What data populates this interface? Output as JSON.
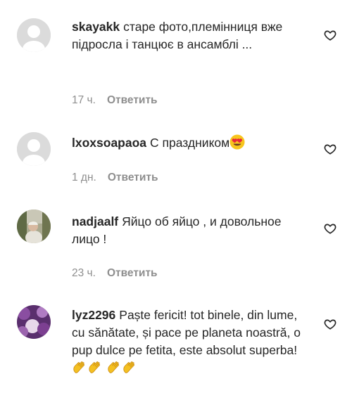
{
  "comments": [
    {
      "username": "skayakk",
      "text": "старе фото,племінниця вже підросла і танцює в ансамблі ...",
      "time": "17 ч.",
      "reply_label": "Ответить",
      "avatar": "default-avatar"
    },
    {
      "username": "lxoxsoapaoa",
      "text": "С праздником",
      "emoji": "heart-eyes-emoji",
      "time": "1 дн.",
      "reply_label": "Ответить",
      "avatar": "default-avatar"
    },
    {
      "username": "nadjaalf",
      "text": "Яйцо об яйцо , и довольное лицо !",
      "time": "23 ч.",
      "reply_label": "Ответить",
      "avatar": "photo-avatar"
    },
    {
      "username": "lyz2296",
      "text": "Paște fericit! tot binele, din lume, cu sănătate, și pace pe planeta noastră, o pup dulce pe fetita, este absolut superba!",
      "emoji": "clapping-hands-emoji",
      "time": "",
      "reply_label": "",
      "avatar": "photo-avatar"
    }
  ],
  "icons": {
    "like": "heart-outline-icon"
  },
  "colors": {
    "meta": "#8e8e8e",
    "text": "#262626",
    "avatar_bg": "#e2e2e2"
  }
}
